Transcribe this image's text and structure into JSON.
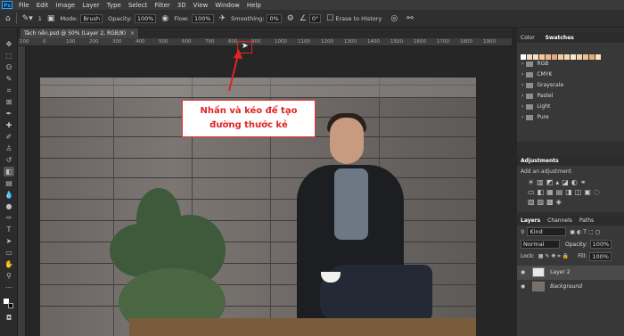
{
  "app": {
    "logo": "Ps"
  },
  "menu": [
    "File",
    "Edit",
    "Image",
    "Layer",
    "Type",
    "Select",
    "Filter",
    "3D",
    "View",
    "Window",
    "Help"
  ],
  "options": {
    "brush_size": "1",
    "mode_label": "Mode:",
    "mode_value": "Brush",
    "opacity_label": "Opacity:",
    "opacity_value": "100%",
    "flow_label": "Flow:",
    "flow_value": "100%",
    "smoothing_label": "Smoothing:",
    "smoothing_value": "0%",
    "angle_value": "0°",
    "erase_history": "Erase to History"
  },
  "document_tab": {
    "title": "Tách nền.psd @ 50% (Layer 2, RGB/8)",
    "close": "×"
  },
  "ruler": {
    "ticks": [
      "100",
      "0",
      "100",
      "200",
      "300",
      "400",
      "500",
      "600",
      "700",
      "800",
      "900",
      "1000",
      "1100",
      "1200",
      "1300",
      "1400",
      "1500",
      "1600",
      "1700",
      "1800",
      "1900"
    ]
  },
  "callout": {
    "line1": "Nhấn và kéo để tạo",
    "line2": "đường thước kẻ"
  },
  "panels": {
    "color_tab": "Color",
    "swatches_tab": "Swatches",
    "swatch_colors": [
      "#ffffff",
      "#f3d7c0",
      "#f6e0c6",
      "#f7c89a",
      "#f0b98d",
      "#e9a87c",
      "#f3caa8",
      "#f8d7b5",
      "#fbe6cf",
      "#f5d2a8",
      "#edc294",
      "#e2ad76",
      "#f9e3c4"
    ],
    "folders": [
      "RGB",
      "CMYK",
      "Grayscale",
      "Pastel",
      "Light",
      "Pure"
    ],
    "adjustments_tab": "Adjustments",
    "add_adjustment": "Add an adjustment",
    "layers_tab": "Layers",
    "channels_tab": "Channels",
    "paths_tab": "Paths",
    "kind_label": "Kind",
    "blend_mode": "Normal",
    "opacity_label": "Opacity:",
    "opacity_value": "100%",
    "lock_label": "Lock:",
    "fill_label": "Fill:",
    "fill_value": "100%",
    "layers": [
      "Layer 2",
      "Background"
    ]
  }
}
